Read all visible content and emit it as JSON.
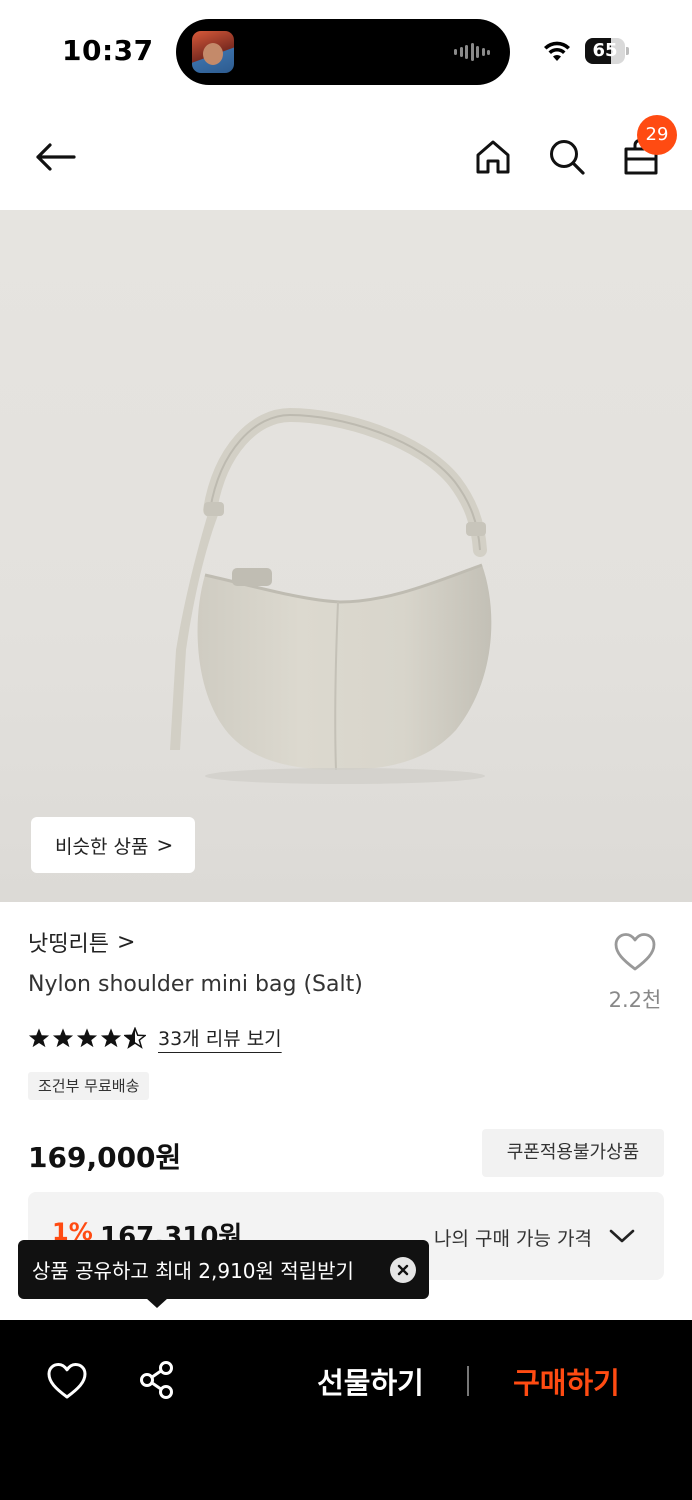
{
  "status_bar": {
    "time": "10:37",
    "battery": "65",
    "battery_level_percent": 65,
    "icons": [
      "wifi-icon",
      "battery-icon",
      "audio-wave-icon"
    ]
  },
  "top_nav": {
    "icons": [
      "back-arrow-icon",
      "home-icon",
      "search-icon",
      "shopping-bag-icon"
    ],
    "cart_count": "29"
  },
  "product_image": {
    "similar_button_label": "비슷한 상품",
    "similar_button_chevron": ">"
  },
  "product": {
    "brand": "낫띵리튼",
    "brand_chevron": ">",
    "name": "Nylon shoulder mini bag (Salt)",
    "like_count": "2.2천",
    "rating_stars": 4.5,
    "review_link": "33개 리뷰 보기",
    "shipping_tag": "조건부 무료배송",
    "price": "169,000원",
    "coupon_tag": "쿠폰적용불가상품"
  },
  "member_price": {
    "discount": "1%",
    "price": "167,310원",
    "label": "나의 구매 가능 가격"
  },
  "tooltip": {
    "text": "상품 공유하고 최대 2,910원 적립받기",
    "close_icon": "close-icon"
  },
  "bottom_bar": {
    "gift_label": "선물하기",
    "buy_label": "구매하기",
    "icons": [
      "heart-icon",
      "share-icon"
    ]
  },
  "colors": {
    "accent": "#ff4b12",
    "bottom_bar_bg": "#000000",
    "image_bg": "#e4e2de"
  }
}
